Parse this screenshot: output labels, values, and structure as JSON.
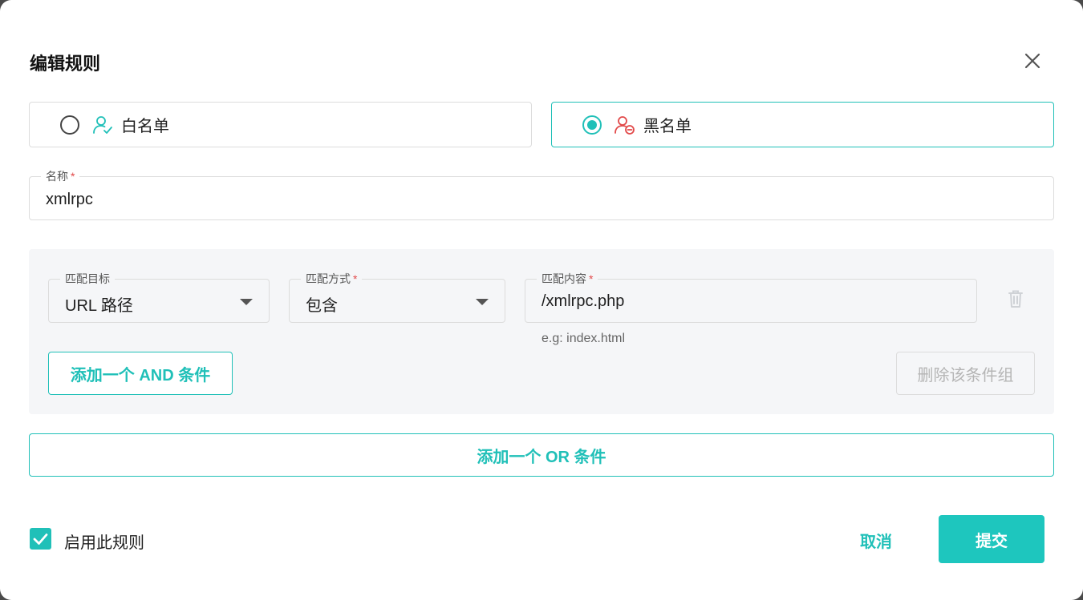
{
  "dialog": {
    "title": "编辑规则",
    "close_icon": "close-icon"
  },
  "rule_type": {
    "options": [
      {
        "label": "白名单",
        "icon": "user-check-icon",
        "selected": false
      },
      {
        "label": "黑名单",
        "icon": "user-block-icon",
        "selected": true
      }
    ]
  },
  "name_field": {
    "label": "名称",
    "required_mark": "*",
    "value": "xmlrpc"
  },
  "condition_group": {
    "match_target": {
      "label": "匹配目标",
      "value": "URL 路径"
    },
    "match_method": {
      "label": "匹配方式",
      "required_mark": "*",
      "value": "包含"
    },
    "match_content": {
      "label": "匹配内容",
      "required_mark": "*",
      "value": "/xmlrpc.php",
      "helper": "e.g: index.html"
    },
    "add_and_label": "添加一个 AND 条件",
    "delete_group_label": "删除该条件组"
  },
  "add_or_label": "添加一个 OR 条件",
  "footer": {
    "enable_label": "启用此规则",
    "enable_checked": true,
    "cancel_label": "取消",
    "submit_label": "提交"
  },
  "colors": {
    "accent": "#1ec6be",
    "danger": "#e24a4a",
    "disabled_text": "#b5b5b5"
  }
}
